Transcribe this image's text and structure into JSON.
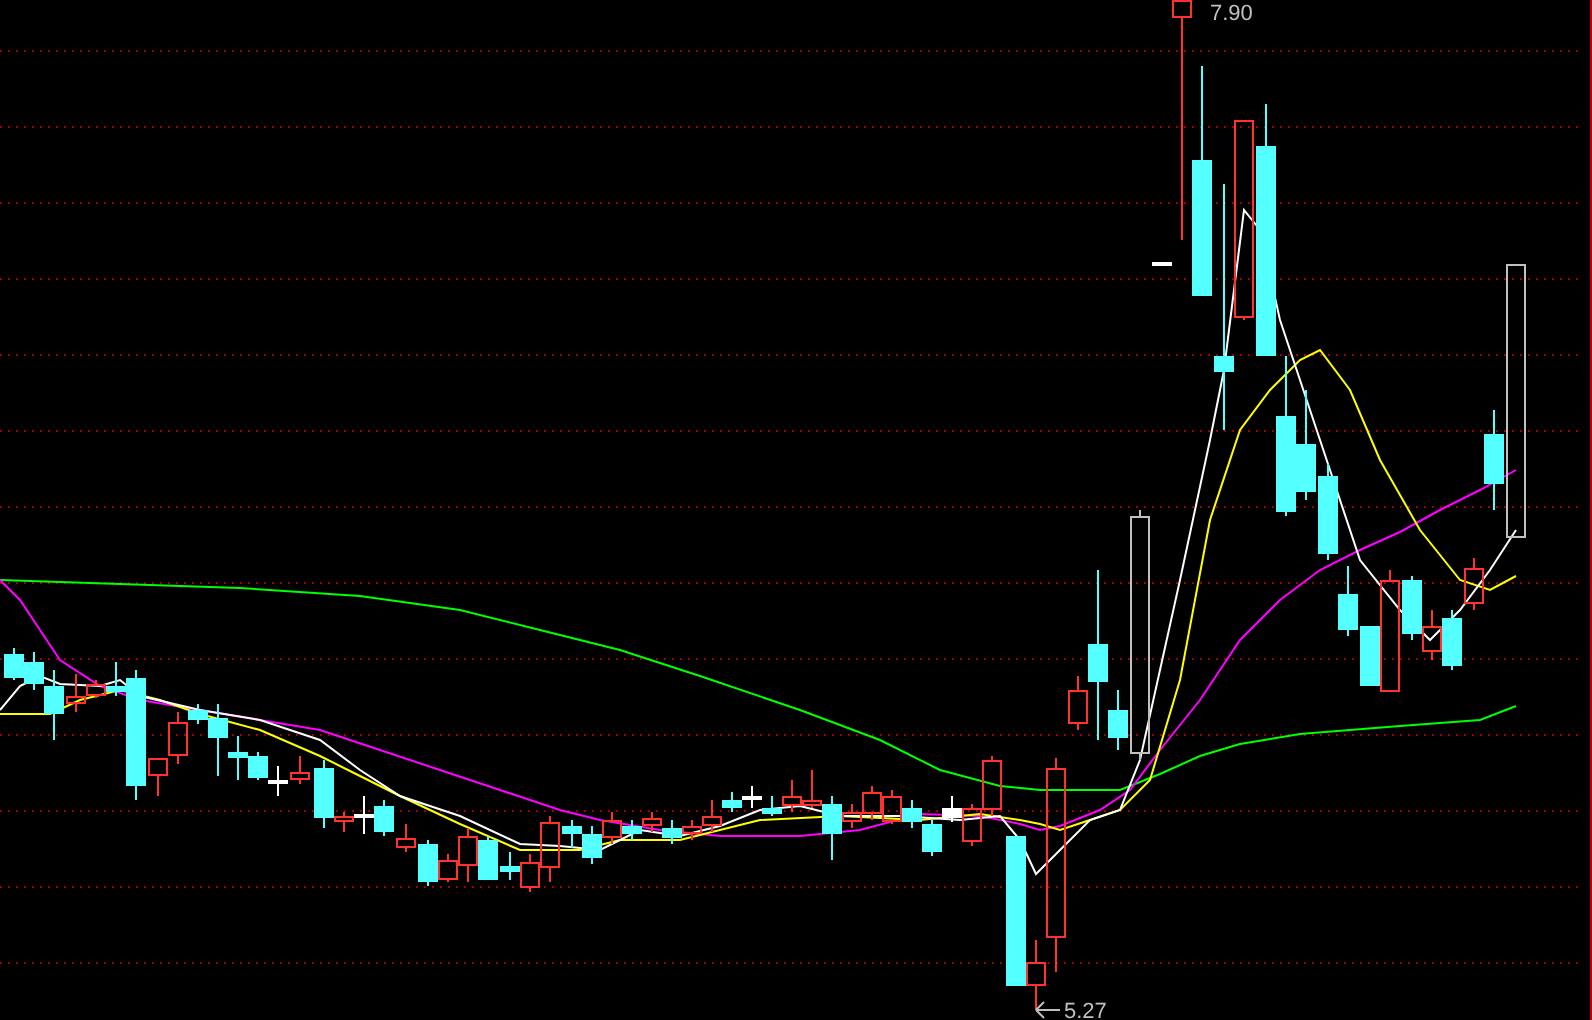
{
  "chart": {
    "high_label": "7.90",
    "low_label": "5.27"
  }
}
